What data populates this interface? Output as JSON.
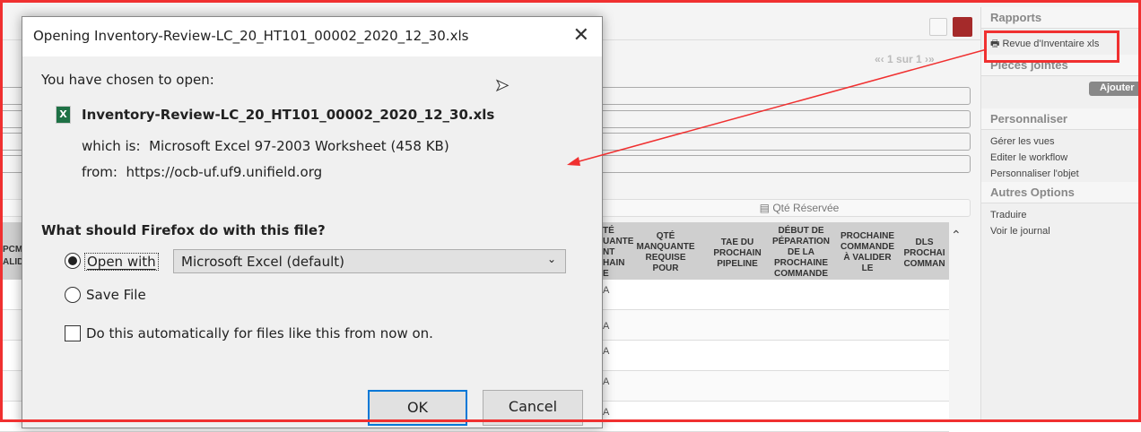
{
  "background": {
    "pagination": "1 sur 1",
    "tab_label": "Qté Réservée",
    "left_partial_header": [
      "PCM",
      "ALID"
    ],
    "columns": [
      {
        "label": "TÉ\nUANTE\nNT\nHAIN\nE"
      },
      {
        "label": "QTÉ\nMANQUANTE\nREQUISE\nPOUR"
      },
      {
        "label": "TAE DU\nPROCHAIN\nPIPELINE"
      },
      {
        "label": "DÉBUT DE\nPÉPARATION\nDE LA\nPROCHAINE\nCOMMANDE"
      },
      {
        "label": "PROCHAINE\nCOMMANDE\nÀ VALIDER\nLE"
      },
      {
        "label": "DLS\nPROCHAI\nCOMMAN"
      }
    ],
    "row_partial_text": [
      "A",
      "A",
      "A",
      "A",
      "A"
    ]
  },
  "sidebar": {
    "rapports_title": "Rapports",
    "report_item": "Revue d'Inventaire xls",
    "attachments_title": "Pièces jointes",
    "add_button": "Ajouter",
    "customize_title": "Personnaliser",
    "customize_items": [
      "Gérer les vues",
      "Editer le workflow",
      "Personnaliser l'objet"
    ],
    "other_title": "Autres Options",
    "other_items": [
      "Traduire",
      "Voir le journal"
    ]
  },
  "dialog": {
    "title": "Opening Inventory-Review-LC_20_HT101_00002_2020_12_30.xls",
    "intro": "You have chosen to open:",
    "filename": "Inventory-Review-LC_20_HT101_00002_2020_12_30.xls",
    "which_is_label": "which is:",
    "which_is_value": "Microsoft Excel 97-2003 Worksheet (458 KB)",
    "from_label": "from:",
    "from_value": "https://ocb-uf.uf9.unifield.org",
    "question": "What should Firefox do with this file?",
    "open_with_label": "Open with",
    "open_with_value": "Microsoft Excel (default)",
    "save_file_label": "Save File",
    "auto_label": "Do this automatically for files like this from now on.",
    "ok": "OK",
    "cancel": "Cancel"
  },
  "colors": {
    "annotation": "#f03030",
    "accent_button": "#0078d7"
  }
}
